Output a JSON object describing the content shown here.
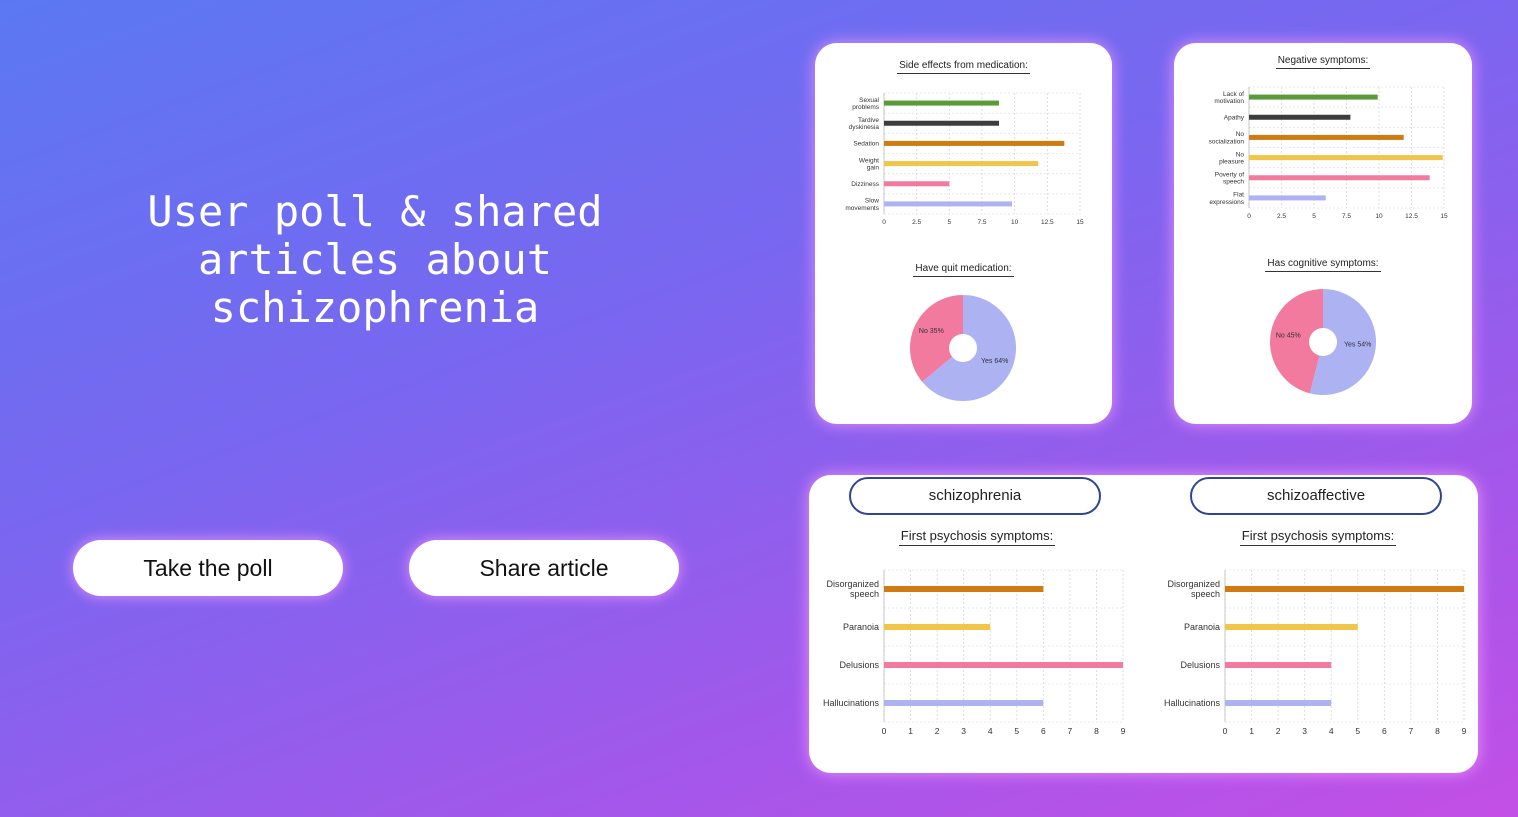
{
  "hero": {
    "title": "User poll & shared articles about schizophrenia"
  },
  "buttons": {
    "poll": "Take the poll",
    "share": "Share article"
  },
  "tabs": {
    "left": "schizophrenia",
    "right": "schizoaffective"
  },
  "colors": {
    "green": "#5a9a3a",
    "dark": "#3d3d3d",
    "orange": "#d07a12",
    "yellow": "#f1c44a",
    "pink": "#f27a9e",
    "lavender": "#adb2f2"
  },
  "chart_data": [
    {
      "type": "bar",
      "orientation": "horizontal",
      "title": "Side effects from medication:",
      "categories": [
        [
          "Sexual",
          "problems"
        ],
        [
          "Tardive",
          "dyskinesia"
        ],
        [
          "Sedation"
        ],
        [
          "Weight",
          "gain"
        ],
        [
          "Dizziness"
        ],
        [
          "Slow",
          "movements"
        ]
      ],
      "values": [
        8.8,
        8.8,
        13.8,
        11.8,
        5,
        9.8
      ],
      "colors": [
        "#5a9a3a",
        "#3d3d3d",
        "#d07a12",
        "#f1c44a",
        "#f27a9e",
        "#adb2f2"
      ],
      "xlim": [
        0,
        15
      ],
      "xticks": [
        "0",
        "2.5",
        "5",
        "7.5",
        "10",
        "12.5",
        "15"
      ],
      "grid": true
    },
    {
      "type": "bar",
      "orientation": "horizontal",
      "title": "Negative symptoms:",
      "categories": [
        [
          "Lack of",
          "motivation"
        ],
        [
          "Apathy"
        ],
        [
          "No",
          "socialization"
        ],
        [
          "No",
          "pleasure"
        ],
        [
          "Poverty of",
          "speech"
        ],
        [
          "Flat",
          "expressions"
        ]
      ],
      "values": [
        9.9,
        7.8,
        11.9,
        14.9,
        13.9,
        5.9
      ],
      "colors": [
        "#5a9a3a",
        "#3d3d3d",
        "#d07a12",
        "#f1c44a",
        "#f27a9e",
        "#adb2f2"
      ],
      "xlim": [
        0,
        15
      ],
      "xticks": [
        "0",
        "2.5",
        "5",
        "7.5",
        "10",
        "12.5",
        "15"
      ],
      "grid": true
    },
    {
      "type": "pie",
      "title": "Have quit medication:",
      "slices": [
        {
          "label": "Yes 64%",
          "value": 64,
          "color": "#adb2f2"
        },
        {
          "label": "No 35%",
          "value": 36,
          "color": "#f27a9e"
        }
      ]
    },
    {
      "type": "pie",
      "title": "Has cognitive symptoms:",
      "slices": [
        {
          "label": "Yes 54%",
          "value": 54,
          "color": "#adb2f2"
        },
        {
          "label": "No 45%",
          "value": 46,
          "color": "#f27a9e"
        }
      ]
    },
    {
      "type": "bar",
      "orientation": "horizontal",
      "title": "First psychosis symptoms:",
      "categories": [
        [
          "Disorganized",
          "speech"
        ],
        [
          "Paranoia"
        ],
        [
          "Delusions"
        ],
        [
          "Hallucinations"
        ]
      ],
      "values": [
        6,
        4,
        9,
        6
      ],
      "colors": [
        "#d07a12",
        "#f1c44a",
        "#f27a9e",
        "#adb2f2"
      ],
      "xlim": [
        0,
        9
      ],
      "xticks": [
        "0",
        "1",
        "2",
        "3",
        "4",
        "5",
        "6",
        "7",
        "8",
        "9"
      ],
      "grid": true
    },
    {
      "type": "bar",
      "orientation": "horizontal",
      "title": "First psychosis symptoms:",
      "categories": [
        [
          "Disorganized",
          "speech"
        ],
        [
          "Paranoia"
        ],
        [
          "Delusions"
        ],
        [
          "Hallucinations"
        ]
      ],
      "values": [
        9,
        5,
        4,
        4
      ],
      "colors": [
        "#d07a12",
        "#f1c44a",
        "#f27a9e",
        "#adb2f2"
      ],
      "xlim": [
        0,
        9
      ],
      "xticks": [
        "0",
        "1",
        "2",
        "3",
        "4",
        "5",
        "6",
        "7",
        "8",
        "9"
      ],
      "grid": true
    }
  ]
}
